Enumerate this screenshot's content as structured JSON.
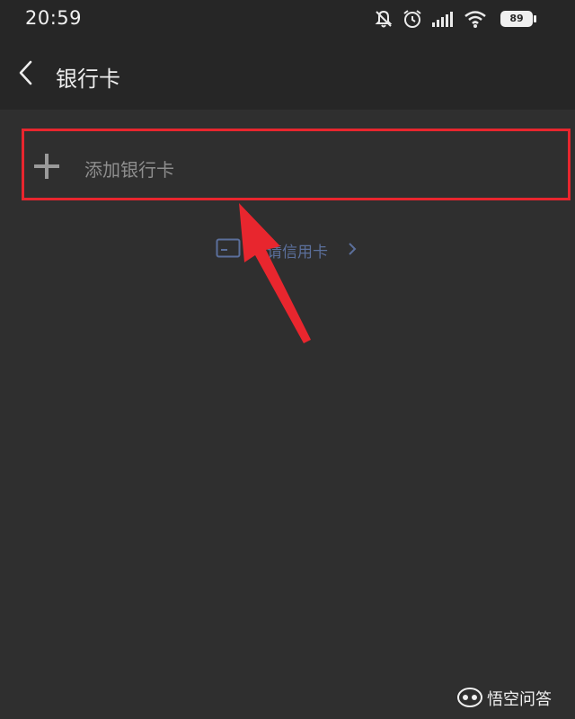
{
  "status_bar": {
    "time": "20:59",
    "battery_level": "89",
    "icons": [
      "mute-bell-icon",
      "alarm-icon",
      "signal-icon",
      "wifi-icon",
      "battery-icon"
    ]
  },
  "header": {
    "title": "银行卡",
    "back_icon": "chevron-left-icon"
  },
  "add_card": {
    "label": "添加银行卡",
    "icon": "plus-icon",
    "highlight_color": "#e8262e"
  },
  "credit_card_link": {
    "label": "申请信用卡",
    "icon": "credit-card-icon",
    "accent_color": "#5b6f9b"
  },
  "annotation": {
    "type": "arrow",
    "color": "#e8262e"
  },
  "watermark": {
    "text": "悟空问答",
    "logo": "wukong-logo-icon"
  }
}
